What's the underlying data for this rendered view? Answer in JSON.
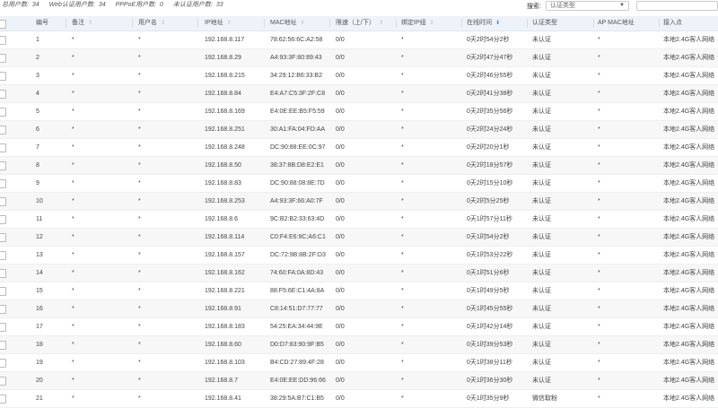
{
  "stats": {
    "total_label": "总用户数:",
    "total_value": "34",
    "web_label": "Web认证用户数:",
    "web_value": "34",
    "pppoe_label": "PPPoE用户数:",
    "pppoe_value": "0",
    "unauth_label": "未认证用户数:",
    "unauth_value": "33"
  },
  "search": {
    "label": "搜索:",
    "auth_type_selected": "认证类型",
    "input_value": ""
  },
  "table": {
    "headers": {
      "no": "编号",
      "note": "备注",
      "username": "用户名",
      "ip": "IP地址",
      "mac": "MAC地址",
      "speed": "限速（上/下）",
      "bind_ip_group": "绑定IP组",
      "online_time": "在线时间",
      "auth_type": "认证类型",
      "ap_mac": "AP MAC地址",
      "access_point": "接入点"
    },
    "rows": [
      {
        "no": "1",
        "note": "*",
        "username": "*",
        "ip": "192.168.8.117",
        "mac": "78:62:56:6C:A2:58",
        "speed": "0/0",
        "bind": "*",
        "time": "0天2时54分2秒",
        "auth": "未认证",
        "ap": "*",
        "access": "本地2.4G客人网络"
      },
      {
        "no": "2",
        "note": "*",
        "username": "*",
        "ip": "192.168.8.29",
        "mac": "A4:93:3F:80:89:43",
        "speed": "0/0",
        "bind": "*",
        "time": "0天2时47分47秒",
        "auth": "未认证",
        "ap": "*",
        "access": "本地2.4G客人网络"
      },
      {
        "no": "3",
        "note": "*",
        "username": "*",
        "ip": "192.168.8.215",
        "mac": "34:29:12:B6:33:B2",
        "speed": "0/0",
        "bind": "*",
        "time": "0天2时46分55秒",
        "auth": "未认证",
        "ap": "*",
        "access": "本地2.4G客人网络"
      },
      {
        "no": "4",
        "note": "*",
        "username": "*",
        "ip": "192.168.8.84",
        "mac": "E4:A7:C5:3F:2F:C8",
        "speed": "0/0",
        "bind": "*",
        "time": "0天2时41分38秒",
        "auth": "未认证",
        "ap": "*",
        "access": "本地2.4G客人网络"
      },
      {
        "no": "5",
        "note": "*",
        "username": "*",
        "ip": "192.168.8.169",
        "mac": "E4:0E:EE:B5:F5:59",
        "speed": "0/0",
        "bind": "*",
        "time": "0天2时35分56秒",
        "auth": "未认证",
        "ap": "*",
        "access": "本地2.4G客人网络"
      },
      {
        "no": "6",
        "note": "*",
        "username": "*",
        "ip": "192.168.8.251",
        "mac": "30:A1:FA:04:FD:AA",
        "speed": "0/0",
        "bind": "*",
        "time": "0天2时24分24秒",
        "auth": "未认证",
        "ap": "*",
        "access": "本地2.4G客人网络"
      },
      {
        "no": "7",
        "note": "*",
        "username": "*",
        "ip": "192.168.8.248",
        "mac": "DC:90:88:EE:0C:97",
        "speed": "0/0",
        "bind": "*",
        "time": "0天2时20分1秒",
        "auth": "未认证",
        "ap": "*",
        "access": "本地2.4G客人网络"
      },
      {
        "no": "8",
        "note": "*",
        "username": "*",
        "ip": "192.168.8.50",
        "mac": "38:37:8B:D8:E2:E1",
        "speed": "0/0",
        "bind": "*",
        "time": "0天2时18分57秒",
        "auth": "未认证",
        "ap": "*",
        "access": "本地2.4G客人网络"
      },
      {
        "no": "9",
        "note": "*",
        "username": "*",
        "ip": "192.168.8.83",
        "mac": "DC:90:88:08:8E:7D",
        "speed": "0/0",
        "bind": "*",
        "time": "0天2时15分10秒",
        "auth": "未认证",
        "ap": "*",
        "access": "本地2.4G客人网络"
      },
      {
        "no": "10",
        "note": "*",
        "username": "*",
        "ip": "192.168.8.253",
        "mac": "A4:93:3F:66:A0:7F",
        "speed": "0/0",
        "bind": "*",
        "time": "0天2时5分25秒",
        "auth": "未认证",
        "ap": "*",
        "access": "本地2.4G客人网络"
      },
      {
        "no": "11",
        "note": "*",
        "username": "*",
        "ip": "192.168.8.6",
        "mac": "9C:B2:B2:33:63:4D",
        "speed": "0/0",
        "bind": "*",
        "time": "0天1时57分11秒",
        "auth": "未认证",
        "ap": "*",
        "access": "本地2.4G客人网络"
      },
      {
        "no": "12",
        "note": "*",
        "username": "*",
        "ip": "192.168.8.114",
        "mac": "C0:F4:E6:9C:A6:C1",
        "speed": "0/0",
        "bind": "*",
        "time": "0天1时54分2秒",
        "auth": "未认证",
        "ap": "*",
        "access": "本地2.4G客人网络"
      },
      {
        "no": "13",
        "note": "*",
        "username": "*",
        "ip": "192.168.8.157",
        "mac": "DC:72:9B:8B:2F:D3",
        "speed": "0/0",
        "bind": "*",
        "time": "0天1时53分22秒",
        "auth": "未认证",
        "ap": "*",
        "access": "本地2.4G客人网络"
      },
      {
        "no": "14",
        "note": "*",
        "username": "*",
        "ip": "192.168.8.162",
        "mac": "74:60:FA:0A:8D:43",
        "speed": "0/0",
        "bind": "*",
        "time": "0天1时51分6秒",
        "auth": "未认证",
        "ap": "*",
        "access": "本地2.4G客人网络"
      },
      {
        "no": "15",
        "note": "*",
        "username": "*",
        "ip": "192.168.8.221",
        "mac": "88:F5:6E:C1:4A:8A",
        "speed": "0/0",
        "bind": "*",
        "time": "0天1时49分5秒",
        "auth": "未认证",
        "ap": "*",
        "access": "本地2.4G客人网络"
      },
      {
        "no": "16",
        "note": "*",
        "username": "*",
        "ip": "192.168.8.91",
        "mac": "C8:14:51:D7:77:77",
        "speed": "0/0",
        "bind": "*",
        "time": "0天1时45分55秒",
        "auth": "未认证",
        "ap": "*",
        "access": "本地2.4G客人网络"
      },
      {
        "no": "17",
        "note": "*",
        "username": "*",
        "ip": "192.168.8.183",
        "mac": "54:25:EA:34:44:9E",
        "speed": "0/0",
        "bind": "*",
        "time": "0天1时42分14秒",
        "auth": "未认证",
        "ap": "*",
        "access": "本地2.4G客人网络"
      },
      {
        "no": "18",
        "note": "*",
        "username": "*",
        "ip": "192.168.8.60",
        "mac": "D0:D7:83:90:9F:B5",
        "speed": "0/0",
        "bind": "*",
        "time": "0天1时39分53秒",
        "auth": "未认证",
        "ap": "*",
        "access": "本地2.4G客人网络"
      },
      {
        "no": "19",
        "note": "*",
        "username": "*",
        "ip": "192.168.8.103",
        "mac": "B4:CD:27:89:4F:28",
        "speed": "0/0",
        "bind": "*",
        "time": "0天1时38分11秒",
        "auth": "未认证",
        "ap": "*",
        "access": "本地2.4G客人网络"
      },
      {
        "no": "20",
        "note": "*",
        "username": "*",
        "ip": "192.168.8.7",
        "mac": "E4:0E:EE:DD:96:66",
        "speed": "0/0",
        "bind": "*",
        "time": "0天1时36分30秒",
        "auth": "未认证",
        "ap": "*",
        "access": "本地2.4G客人网络"
      },
      {
        "no": "21",
        "note": "*",
        "username": "*",
        "ip": "192.168.8.41",
        "mac": "38:29:5A:B7:C1:B5",
        "speed": "0/0",
        "bind": "*",
        "time": "0天1时35分9秒",
        "auth": "微信取粉",
        "ap": "*",
        "access": "本地2.4G客人网络"
      }
    ]
  },
  "colors": {
    "header_bg": "#eef3f9",
    "row_alt_bg": "#f7f7f7",
    "sort_active": "#3b86d4"
  },
  "icons": {
    "sort": "sort-updown-icon",
    "sort_active": "sort-down-active-icon",
    "dropdown": "caret-down-icon",
    "checkbox": "checkbox-icon"
  }
}
